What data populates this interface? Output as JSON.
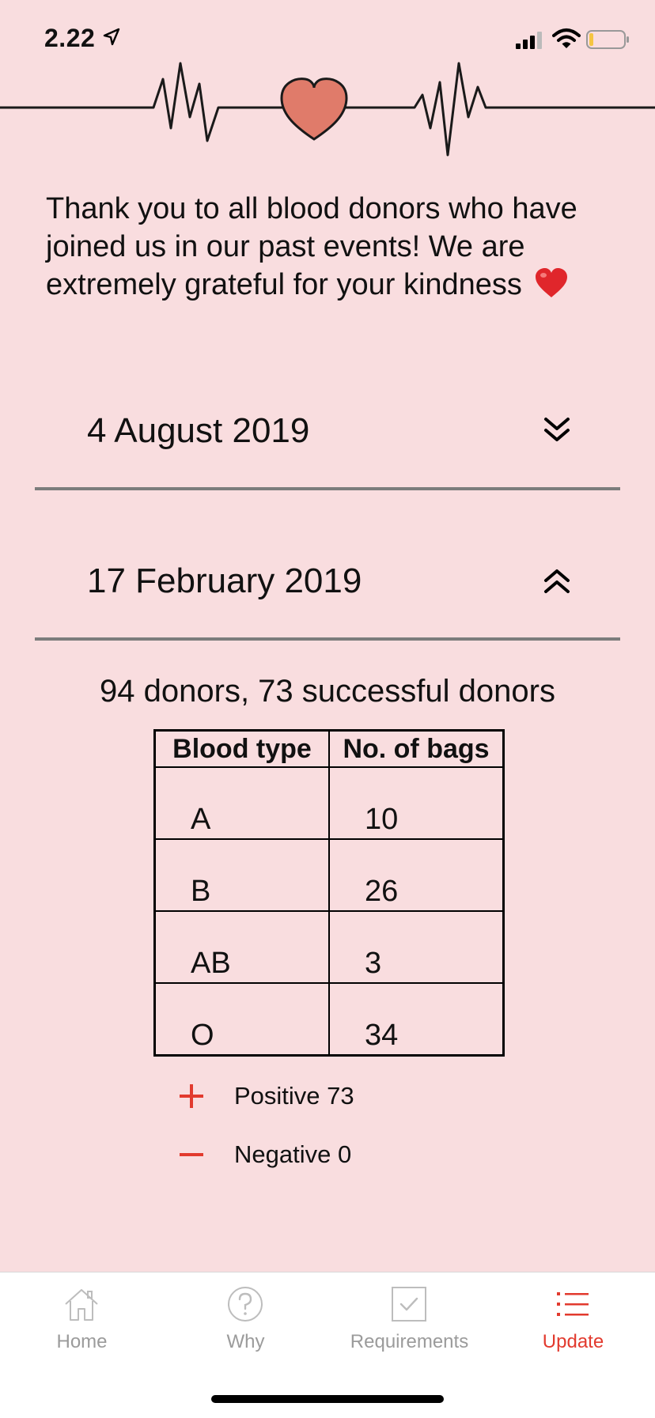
{
  "status_bar": {
    "time": "2.22"
  },
  "intro": {
    "text": "Thank you to all blood donors who have joined us in our past events! We are extremely grateful for your kindness"
  },
  "events": [
    {
      "date": "4 August 2019",
      "expanded": false,
      "chevron_icon": "double-chevron-down-icon"
    },
    {
      "date": "17 February 2019",
      "expanded": true,
      "chevron_icon": "double-chevron-up-icon"
    }
  ],
  "details": {
    "summary": "94 donors, 73 successful donors",
    "table": {
      "headers": [
        "Blood type",
        "No. of bags"
      ],
      "rows": [
        [
          "A",
          "10"
        ],
        [
          "B",
          "26"
        ],
        [
          "AB",
          "3"
        ],
        [
          "O",
          "34"
        ]
      ]
    },
    "legend": {
      "positive": "Positive 73",
      "negative": "Negative 0"
    }
  },
  "tab_bar": {
    "tabs": [
      {
        "label": "Home",
        "icon": "home-icon",
        "active": false
      },
      {
        "label": "Why",
        "icon": "question-icon",
        "active": false
      },
      {
        "label": "Requirements",
        "icon": "checkbox-icon",
        "active": false
      },
      {
        "label": "Update",
        "icon": "list-icon",
        "active": true
      }
    ]
  },
  "colors": {
    "background": "#F9DDDF",
    "accent": "#E23A2E",
    "inactive": "#9B9B9B",
    "heart": "#E07B6A"
  }
}
